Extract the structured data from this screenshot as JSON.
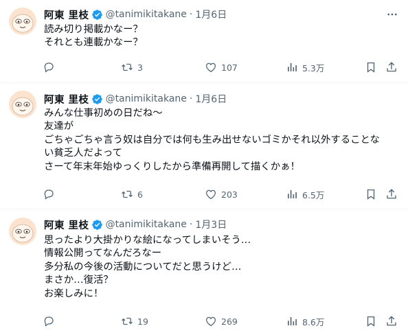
{
  "colors": {
    "text": "#0f1419",
    "muted": "#536471",
    "verified": "#1d9bf0",
    "divider": "#eff3f4"
  },
  "tweets": [
    {
      "author_name": "阿東 里枝",
      "handle": "@tanimikitakane",
      "separator": "·",
      "date": "1月6日",
      "text": "読み切り掲載かなー？\nそれとも連載かなー？",
      "replies": "",
      "retweets": "3",
      "likes": "107",
      "views": "5.3万"
    },
    {
      "author_name": "阿東 里枝",
      "handle": "@tanimikitakane",
      "separator": "·",
      "date": "1月6日",
      "text": "みんな仕事初めの日だね～\n友達が\nごちゃごちゃ言う奴は自分では何も生み出せないゴミかそれ以外することな\nい貧乏人だよって\nさーて年末年始ゆっくりしたから準備再開して描くかぁ！",
      "replies": "",
      "retweets": "6",
      "likes": "203",
      "views": "6.5万"
    },
    {
      "author_name": "阿東 里枝",
      "handle": "@tanimikitakane",
      "separator": "·",
      "date": "1月3日",
      "text": "思ったより大掛かりな絵になってしまいそう…\n情報公開ってなんだろなー\n多分私の今後の活動についてだと思うけど…\nまさか…復活？\nお楽しみに！",
      "replies": "",
      "retweets": "19",
      "likes": "269",
      "views": "8.6万"
    }
  ],
  "icons": {
    "verified": "verified-badge-icon",
    "more": "more-icon",
    "reply": "reply-icon",
    "retweet": "retweet-icon",
    "like": "heart-icon",
    "views": "views-icon",
    "bookmark": "bookmark-icon",
    "share": "share-icon"
  }
}
